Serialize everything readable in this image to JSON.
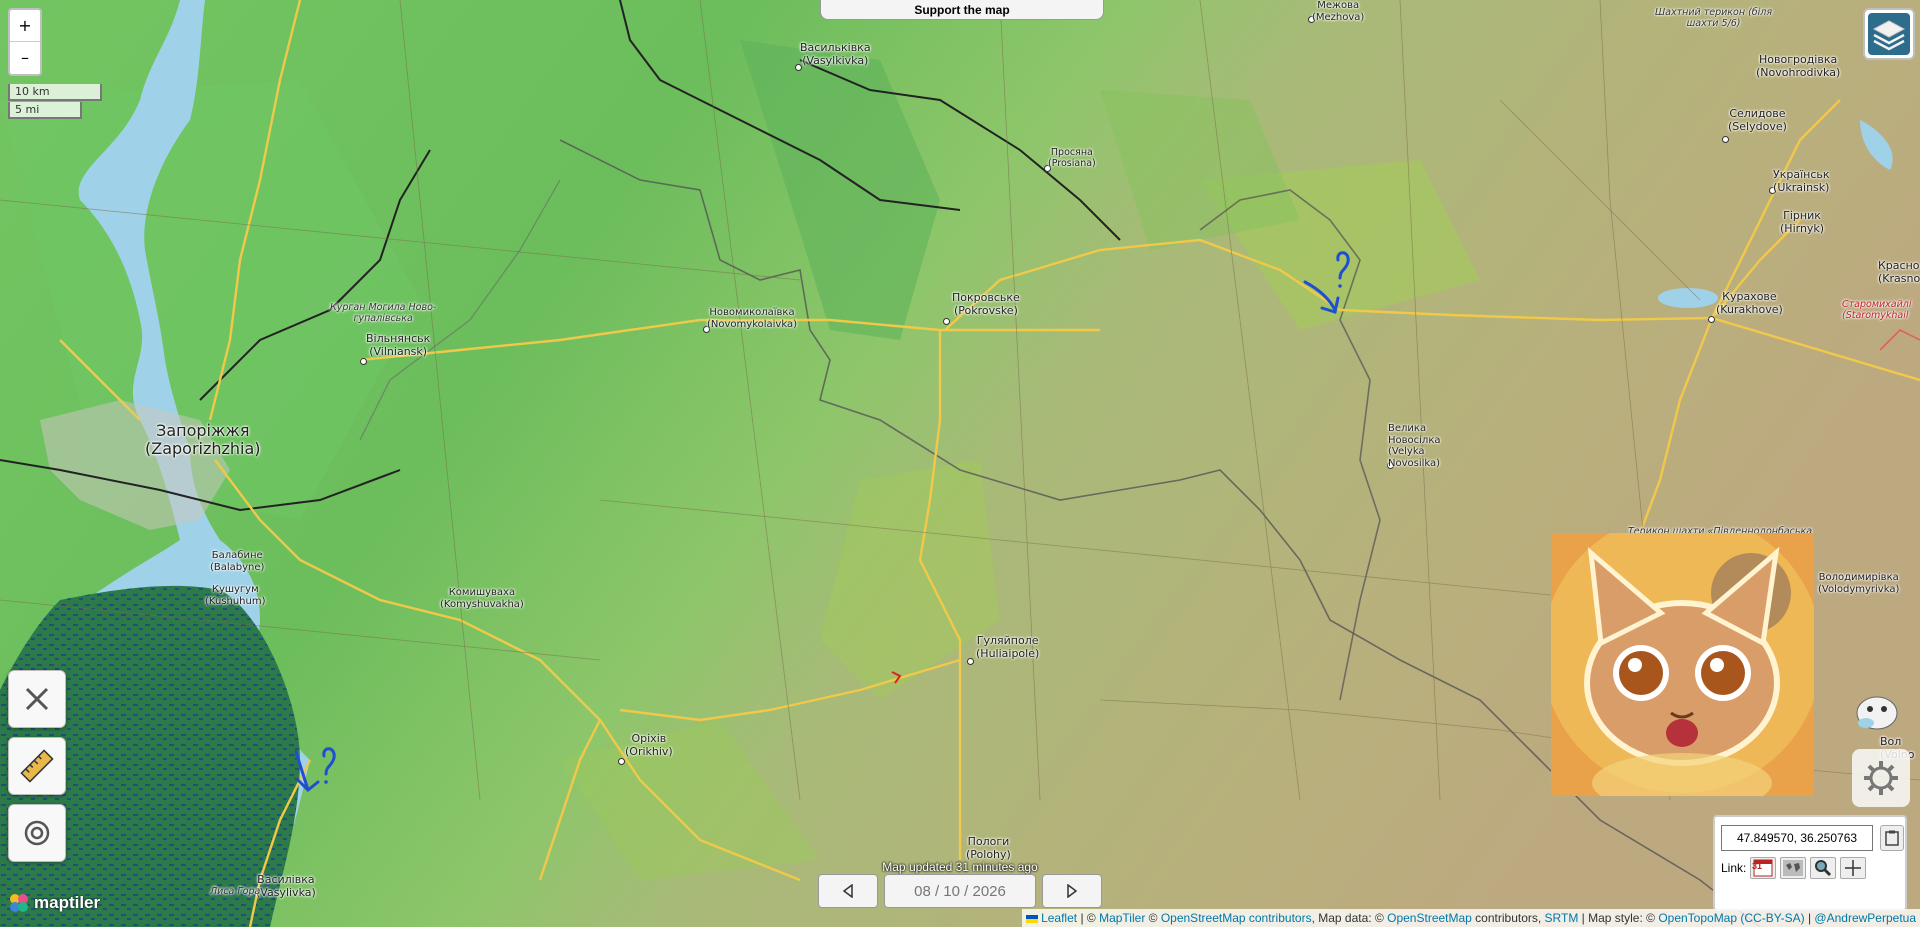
{
  "support_label": "Support the map",
  "zoom": {
    "in": "+",
    "out": "–"
  },
  "scale": {
    "km": "10 km",
    "mi": "5 mi"
  },
  "places": {
    "vasylkivka_n": "Васильківка",
    "vasylkivka_n_en": "(Vasylkivka)",
    "mezhova": "Межова",
    "mezhova_en": "(Mezhova)",
    "terykon": "Шахтний терикон (біля",
    "terykon2": "шахти 5/6)",
    "novohrodivka": "Новогродівка",
    "novohrodivka_en": "(Novohrodivka)",
    "selydove": "Селидове",
    "selydove_en": "(Selydove)",
    "ukrainsk": "Українськ",
    "ukrainsk_en": "(Ukrainsk)",
    "hirnyk": "Гірник",
    "hirnyk_en": "(Hirnyk)",
    "krasno": "Красно",
    "krasno_en": "(Krasno",
    "prosiana": "Просяна",
    "prosiana_en": "(Prosiana)",
    "kurakhove": "Курахове",
    "kurakhove_en": "(Kurakhove)",
    "staromykh": "Старомихайлі",
    "staromykh_en": "(Staromykhail",
    "pokrovske": "Покровське",
    "pokrovske_en": "(Pokrovske)",
    "novomykolaivka": "Новомиколаївка",
    "novomykolaivka_en": "(Novomykolaivka)",
    "kurhan": "Курган Могила Ново-",
    "kurhan2": "гупалівська",
    "vilniansk": "Вільнянськ",
    "vilniansk_en": "(Vilniansk)",
    "zaporizhzhia": "Запоріжжя",
    "zaporizhzhia_en": "(Zaporizhzhia)",
    "velyka": "Велика",
    "velyka2": "Новосілка",
    "velyka_en": "(Velyka",
    "velyka_en2": "Novosilka)",
    "balabyne": "Балабине",
    "balabyne_en": "(Balabyne)",
    "kushuhum": "Кушугум",
    "kushuhum_en": "(Kushuhum)",
    "komyshuvakha": "Комишуваха",
    "komyshuvakha_en": "(Komyshuvakha)",
    "huliaipole": "Гуляйполе",
    "huliaipole_en": "(Huliaipole)",
    "volodymyrivka": "Володимирівка",
    "volodymyrivka_en": "(Volodymyrivka)",
    "terykon_pd": "Терикон шахти «Південнодонбаська",
    "orikhiv": "Оріхів",
    "orikhiv_en": "(Orikhiv)",
    "vol": "Вол",
    "vol_en": "(Volno",
    "polohy": "Пологи",
    "polohy_en": "(Polohy)",
    "vasylivka": "Василівка",
    "vasylivka_en": "(Vasylivka)",
    "lysa": "Лиса Гора"
  },
  "updated": "Map updated 31 minutes ago",
  "date": "08 / 10 / 2026",
  "coords": "47.849570, 36.250763",
  "link_label": "Link:",
  "calendar_day": "31",
  "maptiler": "maptiler",
  "attribution": {
    "leaflet": "Leaflet",
    "sep1": " | © ",
    "maptiler": "MapTiler",
    "sep2": " © ",
    "osm": "OpenStreetMap contributors",
    "mapdata": ", Map data: © ",
    "osm2": "OpenStreetMap",
    "contrib": " contributors, ",
    "srtm": "SRTM",
    "style": " | Map style: © ",
    "otm": "OpenTopoMap",
    "ccbysa": "(CC-BY-SA)",
    "sep3": " | ",
    "author": "@AndrewPerpetua"
  },
  "colors": {
    "green": "#6fbf5f",
    "tan": "#b7b27a",
    "water": "#9fd2e8",
    "road": "#f0c94a",
    "arrow": "#1f4fd1"
  }
}
